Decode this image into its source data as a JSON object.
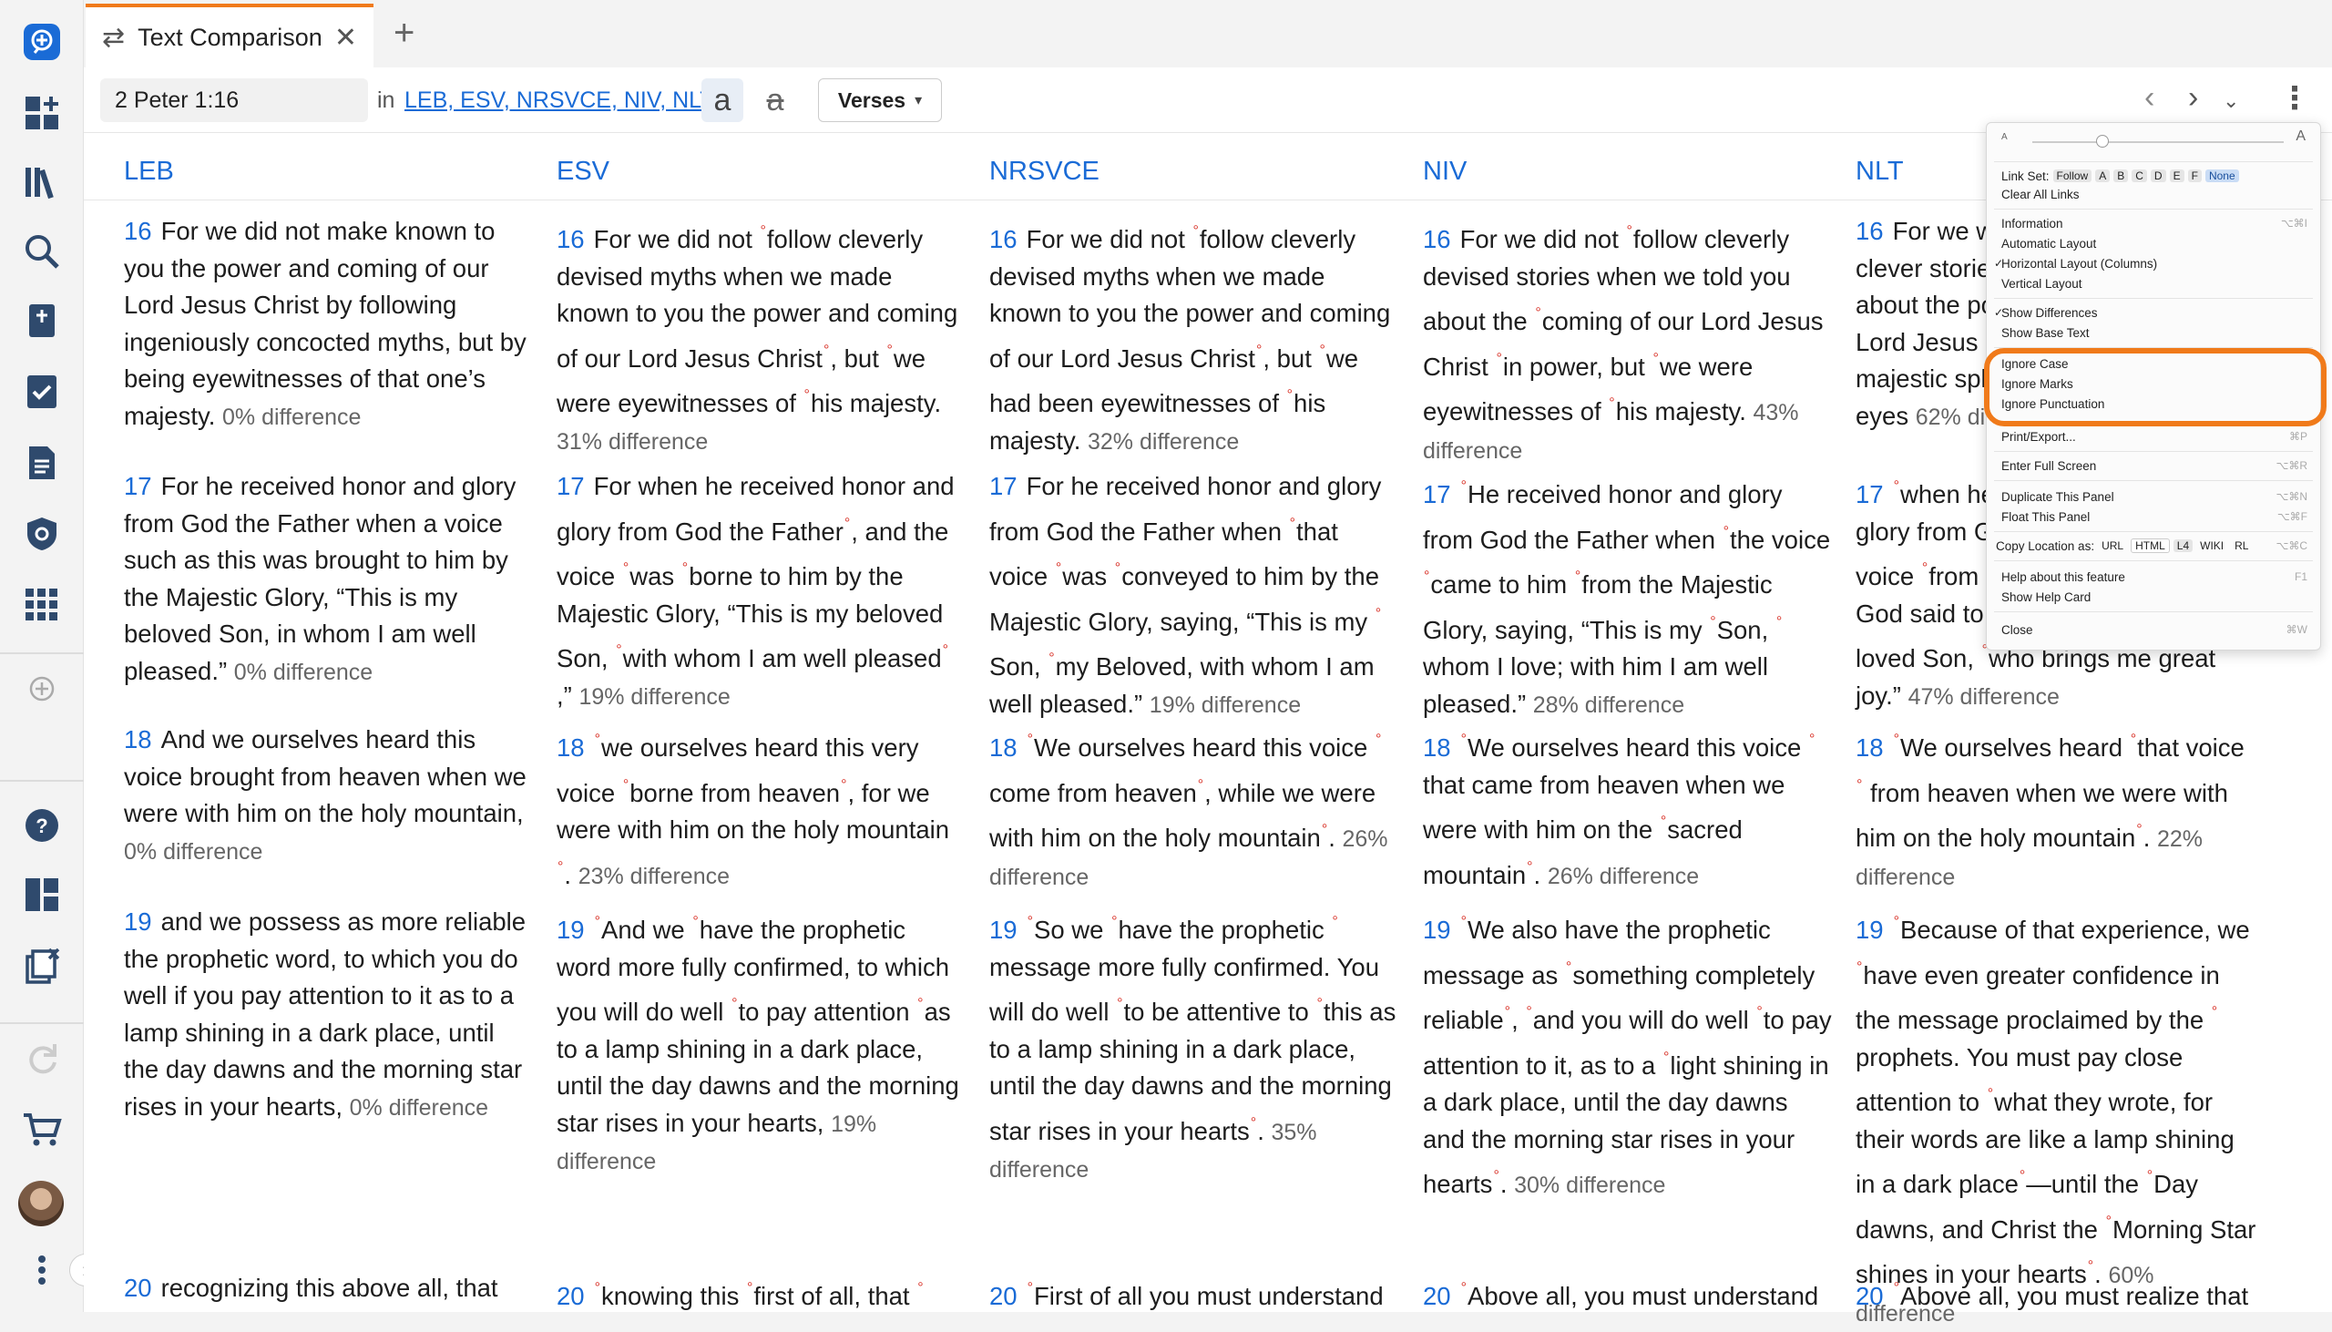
{
  "tab": {
    "title": "Text Comparison",
    "close": "✕",
    "icon": "⇄",
    "new": "+"
  },
  "toolbar": {
    "reference": "2 Peter 1:16",
    "in": "in",
    "versions": "LEB, ESV, NRSVCE, NIV, NLT",
    "case_btn": "a",
    "strike_btn": "a",
    "verses": "Verses",
    "prev": "‹",
    "next": "›",
    "down": "⌄",
    "more": "⋮"
  },
  "columns": [
    {
      "name": "LEB"
    },
    {
      "name": "ESV"
    },
    {
      "name": "NRSVCE"
    },
    {
      "name": "NIV"
    },
    {
      "name": "NLT"
    }
  ],
  "verses": {
    "LEB": [
      {
        "n": "16",
        "html": "For we did not make known to you the power and coming of our Lord Jesus Christ by following ingeniously concocted myths, but by being eyewitnesses of that one’s majesty.",
        "diff": "0% difference"
      },
      {
        "n": "17",
        "html": "For he received honor and glory from God the Father when a voice such as this was brought to him by the Majestic Glory, “This is my beloved Son, in whom I am well pleased.”",
        "diff": "0% difference"
      },
      {
        "n": "18",
        "html": "And we ourselves heard this voice brought from heaven when we were with him on the holy mountain,",
        "diff": "0% difference"
      },
      {
        "n": "19",
        "html": "and we possess as more reliable the prophetic word, to which you do well if you pay attention to it as to a lamp shining in a dark place, until the day dawns and the morning star rises in your hearts,",
        "diff": "0% difference"
      },
      {
        "n": "20",
        "html": "recognizing this above all, that",
        "diff": ""
      }
    ],
    "ESV": [
      {
        "n": "16",
        "html": "For we did not °follow cleverly devised myths when we made known to you the power and coming of our Lord Jesus Christ°, but °we were eyewitnesses of °his majesty.",
        "diff": "31% difference"
      },
      {
        "n": "17",
        "html": "For when he received honor and glory from God the Father°, and the voice °was °borne to him by the Majestic Glory, “This is my beloved Son, °with whom I am well pleased° ,”",
        "diff": "19% difference"
      },
      {
        "n": "18",
        "html": "°we ourselves heard this very voice °borne from heaven°, for we were with him on the holy mountain °.",
        "diff": "23% difference"
      },
      {
        "n": "19",
        "html": "°And we °have the prophetic word more fully confirmed, to which you will do well °to pay attention °as to a lamp shining in a dark place, until the day dawns and the morning star rises in your hearts,",
        "diff": "19% difference"
      },
      {
        "n": "20",
        "html": "°knowing this °first of all, that °",
        "diff": ""
      }
    ],
    "NRSVCE": [
      {
        "n": "16",
        "html": "For we did not °follow cleverly devised myths when we made known to you the power and coming of our Lord Jesus Christ°, but °we had been eyewitnesses of °his majesty.",
        "diff": "32% difference"
      },
      {
        "n": "17",
        "html": "For he received honor and glory from God the Father when °that voice °was °conveyed to him by the Majestic Glory, saying, “This is my ° Son, °my Beloved, with whom I am well pleased.”",
        "diff": "19% difference"
      },
      {
        "n": "18",
        "html": "°We ourselves heard this voice ° come from heaven°, while we were with him on the holy mountain°.",
        "diff": "26% difference"
      },
      {
        "n": "19",
        "html": "°So we °have the prophetic ° message more fully confirmed. You will do well °to be attentive to °this as to a lamp shining in a dark place, until the day dawns and the morning star rises in your hearts°.",
        "diff": "35% difference"
      },
      {
        "n": "20",
        "html": "°First of all you must understand",
        "diff": ""
      }
    ],
    "NIV": [
      {
        "n": "16",
        "html": "For we did not °follow cleverly devised stories when we told you about the °coming of our Lord Jesus Christ °in power, but °we were eyewitnesses of °his majesty.",
        "diff": "43% difference"
      },
      {
        "n": "17",
        "html": "°He received honor and glory from God the Father when °the voice °came to him °from the Majestic Glory, saying, “This is my °Son, ° whom I love; with him I am well pleased.”",
        "diff": "28% difference"
      },
      {
        "n": "18",
        "html": "°We ourselves heard this voice ° that came from heaven when we were with him on the °sacred mountain°.",
        "diff": "26% difference"
      },
      {
        "n": "19",
        "html": "°We also have the prophetic message as °something completely reliable°, °and you will do well °to pay attention to it, as to a °light shining in a dark place, until the day dawns and the morning star rises in your hearts°.",
        "diff": "30% difference"
      },
      {
        "n": "20",
        "html": "°Above all, you must understand",
        "diff": ""
      }
    ],
    "NLT": [
      {
        "n": "16",
        "html": "For we were not making up clever stories when we told you about the power and coming of our Lord Jesus Christ. We saw his majestic splendor with our own eyes",
        "diff": "62% difference"
      },
      {
        "n": "17",
        "html": "°when he received honor and glory from God the Father. The voice °from the majestic glory of God said to him, “This is my dearly loved Son, °who brings me great joy.”",
        "diff": "47% difference"
      },
      {
        "n": "18",
        "html": "°We ourselves heard °that voice ° from heaven when we were with him on the holy mountain°.",
        "diff": "22% difference"
      },
      {
        "n": "19",
        "html": "°Because of that experience, we °have even greater confidence in the message proclaimed by the ° prophets. You must pay close attention to °what they wrote, for their words are like a lamp shining in a dark place°—until the °Day dawns, and Christ the °Morning Star shines in your hearts°.",
        "diff": "60% difference"
      },
      {
        "n": "20",
        "html": "°Above all, you must realize that",
        "diff": ""
      }
    ]
  },
  "menu": {
    "zoom_small": "A",
    "zoom_large": "A",
    "link_set_label": "Link Set:",
    "link_set_options": [
      "Follow",
      "A",
      "B",
      "C",
      "D",
      "E",
      "F",
      "None"
    ],
    "clear_links": "Clear All Links",
    "information": "Information",
    "information_sc": "⌥⌘I",
    "automatic_layout": "Automatic Layout",
    "horizontal_layout": "Horizontal Layout (Columns)",
    "vertical_layout": "Vertical Layout",
    "show_differences": "Show Differences",
    "show_base_text": "Show Base Text",
    "ignore_case": "Ignore Case",
    "ignore_marks": "Ignore Marks",
    "ignore_punctuation": "Ignore Punctuation",
    "print_export": "Print/Export...",
    "print_sc": "⌘P",
    "full_screen": "Enter Full Screen",
    "full_screen_sc": "⌥⌘R",
    "duplicate_panel": "Duplicate This Panel",
    "duplicate_sc": "⌥⌘N",
    "float_panel": "Float This Panel",
    "float_sc": "⌥⌘F",
    "copy_location_label": "Copy Location as:",
    "copy_location_options": [
      "URL",
      "HTML",
      "L4",
      "WIKI",
      "RL"
    ],
    "copy_sc": "⌥⌘C",
    "help_feature": "Help about this feature",
    "help_sc": "F1",
    "help_card": "Show Help Card",
    "close": "Close",
    "close_sc": "⌘W",
    "check": "✓"
  },
  "colors": {
    "accent": "#1a6bd6",
    "highlight": "#f07a1a",
    "marker": "#d9352b"
  }
}
